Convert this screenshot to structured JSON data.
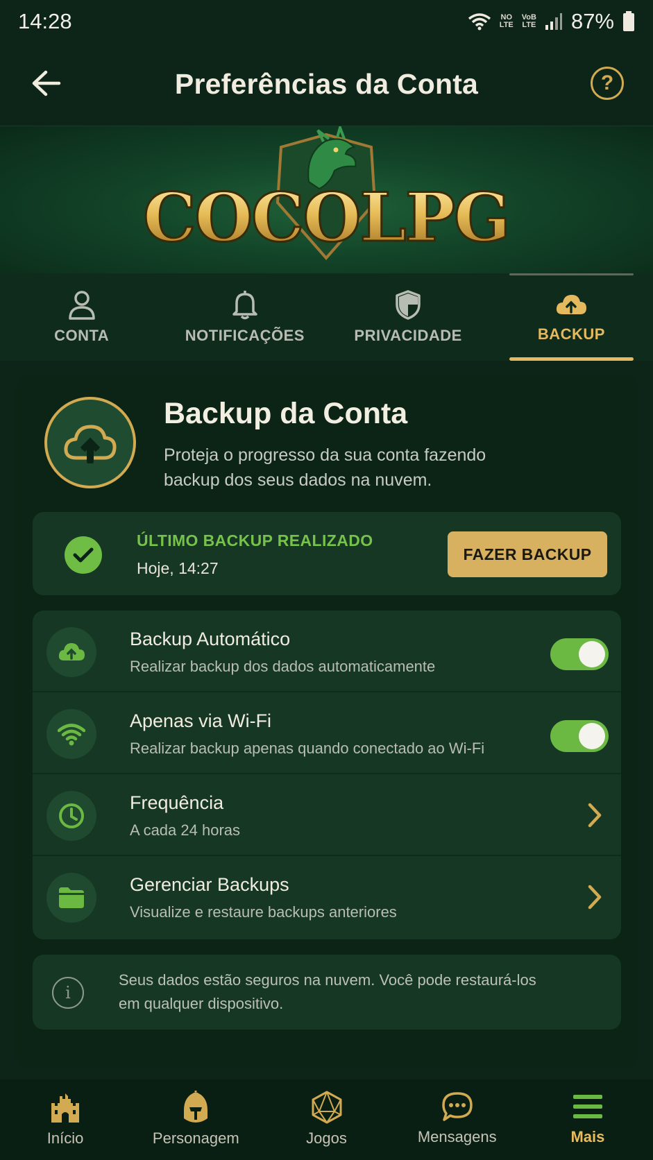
{
  "status_bar": {
    "time": "14:28",
    "battery": "87%",
    "lte1": "LTE",
    "lte2": "LTE"
  },
  "header": {
    "title": "Preferências da Conta",
    "help_label": "?"
  },
  "banner": {
    "logo_text": "COCOLPG"
  },
  "tabs": [
    {
      "label": "CONTA",
      "icon": "user-icon",
      "active": false
    },
    {
      "label": "NOTIFICAÇÕES",
      "icon": "bell-icon",
      "active": false
    },
    {
      "label": "PRIVACIDADE",
      "icon": "shield-icon",
      "active": false
    },
    {
      "label": "BACKUP",
      "icon": "cloud-upload-icon",
      "active": true
    }
  ],
  "backup": {
    "title": "Backup da Conta",
    "description": "Proteja o progresso da sua conta fazendo backup dos seus dados na nuvem.",
    "last_backup_label": "ÚLTIMO BACKUP REALIZADO",
    "last_backup_time": "Hoje, 14:27",
    "backup_button": "FAZER BACKUP"
  },
  "settings": [
    {
      "title": "Backup Automático",
      "subtitle": "Realizar backup dos dados automaticamente",
      "icon": "cloud-upload-icon",
      "control": "toggle",
      "enabled": true
    },
    {
      "title": "Apenas via Wi-Fi",
      "subtitle": "Realizar backup apenas quando conectado ao Wi-Fi",
      "icon": "wifi-icon",
      "control": "toggle",
      "enabled": true
    },
    {
      "title": "Frequência",
      "subtitle": "A cada 24 horas",
      "icon": "clock-icon",
      "control": "chevron"
    },
    {
      "title": "Gerenciar Backups",
      "subtitle": "Visualize e restaure backups anteriores",
      "icon": "folder-icon",
      "control": "chevron"
    }
  ],
  "info": {
    "text": "Seus dados estão seguros na nuvem. Você pode restaurá-los em qualquer dispositivo.",
    "icon_glyph": "i"
  },
  "bottom_nav": [
    {
      "label": "Início",
      "icon": "castle-icon",
      "active": false
    },
    {
      "label": "Personagem",
      "icon": "helmet-icon",
      "active": false
    },
    {
      "label": "Jogos",
      "icon": "d20-icon",
      "active": false
    },
    {
      "label": "Mensagens",
      "icon": "chat-icon",
      "active": false
    },
    {
      "label": "Mais",
      "icon": "menu-icon",
      "active": true
    }
  ],
  "colors": {
    "accent_gold": "#d2aa52",
    "green_on": "#6bb843",
    "background": "#0d2418",
    "card": "#153724"
  }
}
